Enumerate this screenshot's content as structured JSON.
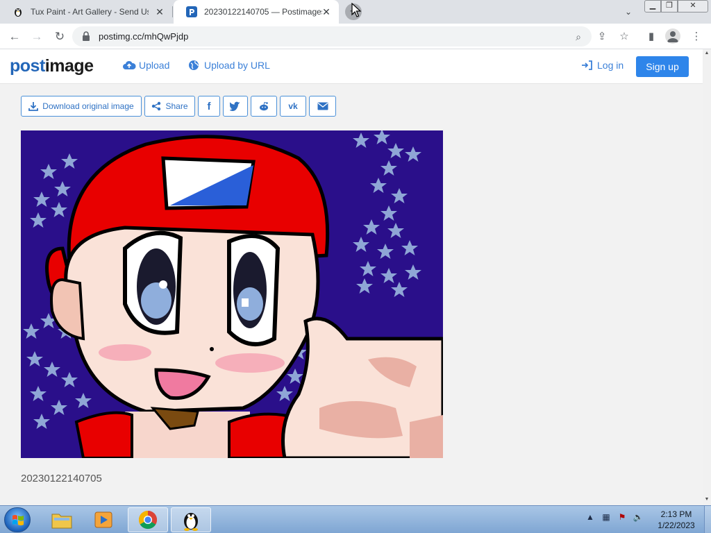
{
  "browser": {
    "tabs": [
      {
        "title": "Tux Paint - Art Gallery - Send Us",
        "icon": "penguin-icon",
        "active": false
      },
      {
        "title": "20230122140705 — Postimages",
        "icon": "postimages-favicon",
        "active": true
      }
    ],
    "url": "postimg.cc/mhQwPjdp"
  },
  "site": {
    "logo_part1": "post",
    "logo_part2": "image",
    "upload": "Upload",
    "upload_url": "Upload by URL",
    "login": "Log in",
    "signup": "Sign up",
    "accent": "#2e85ea"
  },
  "actions": {
    "download": "Download original image",
    "share": "Share"
  },
  "image": {
    "caption": "20230122140705"
  },
  "taskbar": {
    "time": "2:13 PM",
    "date": "1/22/2023"
  }
}
